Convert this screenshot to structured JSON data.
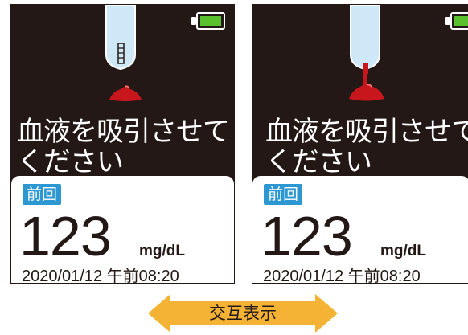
{
  "screens": [
    {
      "message_line1": "血液を吸引させて",
      "message_line2": "ください",
      "badge": "前回",
      "value": "123",
      "unit": "mg/dL",
      "datetime": "2020/01/12 午前08:20"
    },
    {
      "message_line1": "血液を吸引させて",
      "message_line2": "ください",
      "badge": "前回",
      "value": "123",
      "unit": "mg/dL",
      "datetime": "2020/01/12 午前08:20"
    }
  ],
  "alternate_label": "交互表示",
  "colors": {
    "screen_bg": "#231815",
    "battery": "#5ac12e",
    "badge": "#2c97d1",
    "blood": "#c8161d",
    "strip": "#cfe8f7",
    "arrow": "#f5b335"
  },
  "icons": [
    "battery-full-icon",
    "test-strip-icon",
    "blood-drop-icon",
    "double-arrow-icon"
  ]
}
